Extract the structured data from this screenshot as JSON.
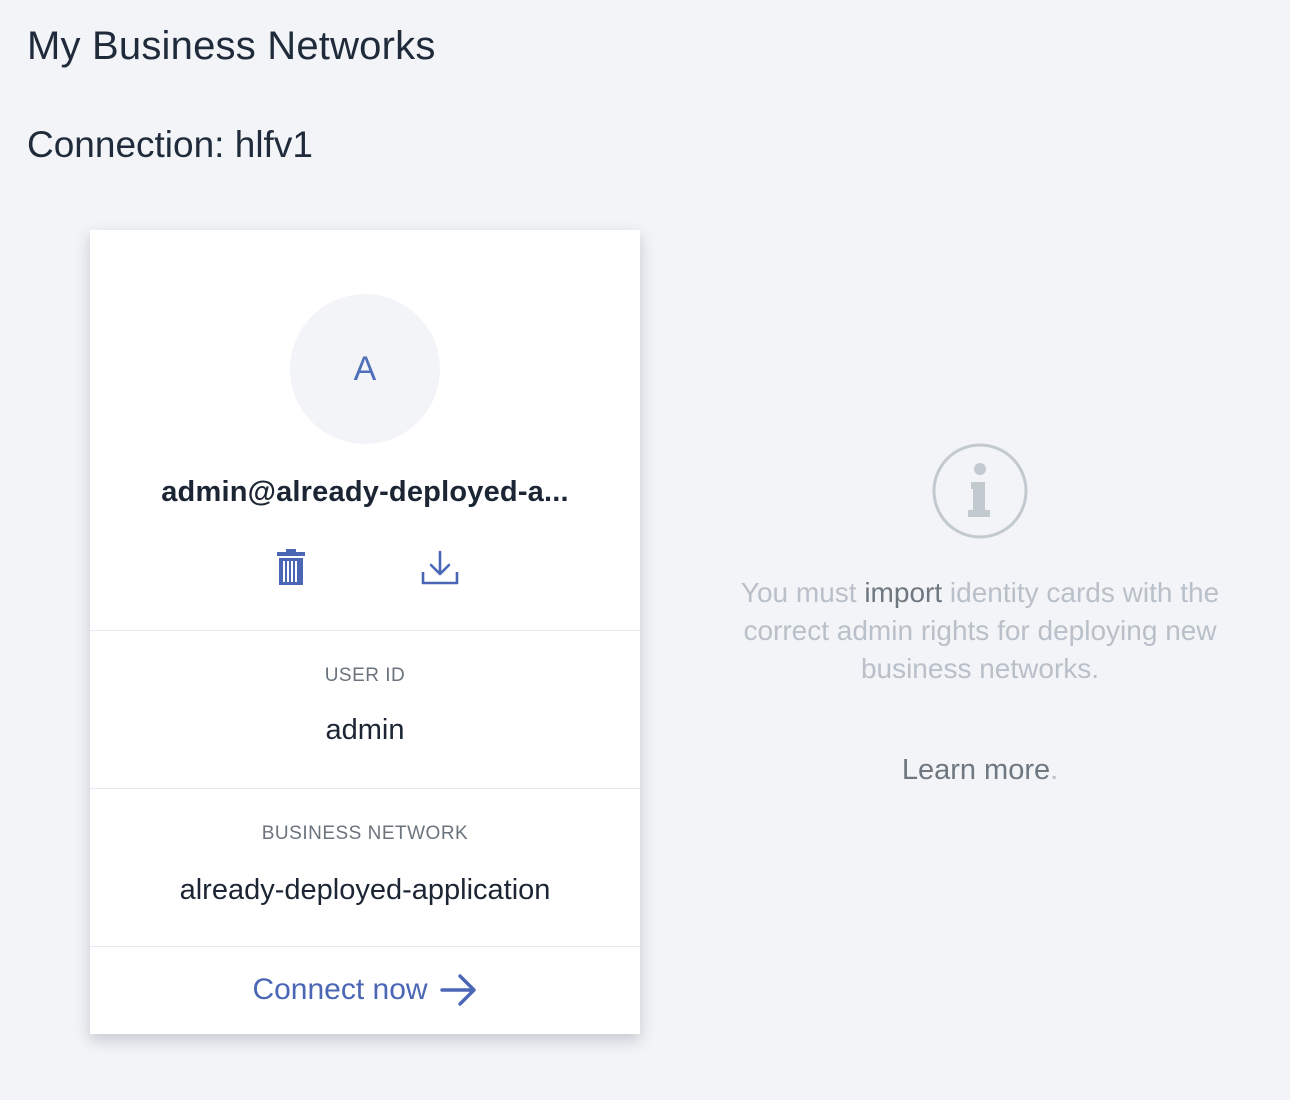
{
  "header": {
    "title": "My Business Networks",
    "connection_label": "Connection: hlfv1"
  },
  "card": {
    "avatar_letter": "A",
    "name": "admin@already-deployed-a...",
    "fields": [
      {
        "label": "USER ID",
        "value": "admin"
      },
      {
        "label": "BUSINESS NETWORK",
        "value": "already-deployed-application"
      }
    ],
    "connect_label": "Connect now",
    "icons": {
      "delete": "trash-icon",
      "export": "download-icon",
      "connect": "arrow-right-icon"
    }
  },
  "info": {
    "icon": "info-circle-icon",
    "text_before": "You must ",
    "link_text": "import",
    "text_after": " identity cards with the correct admin rights for deploying new business networks.",
    "learn_more": "Learn more",
    "learn_more_suffix": "."
  },
  "colors": {
    "background": "#f2f4f7",
    "accent": "#4a66b5",
    "text_dark": "#1c2533",
    "text_muted": "#b9c0c9"
  }
}
